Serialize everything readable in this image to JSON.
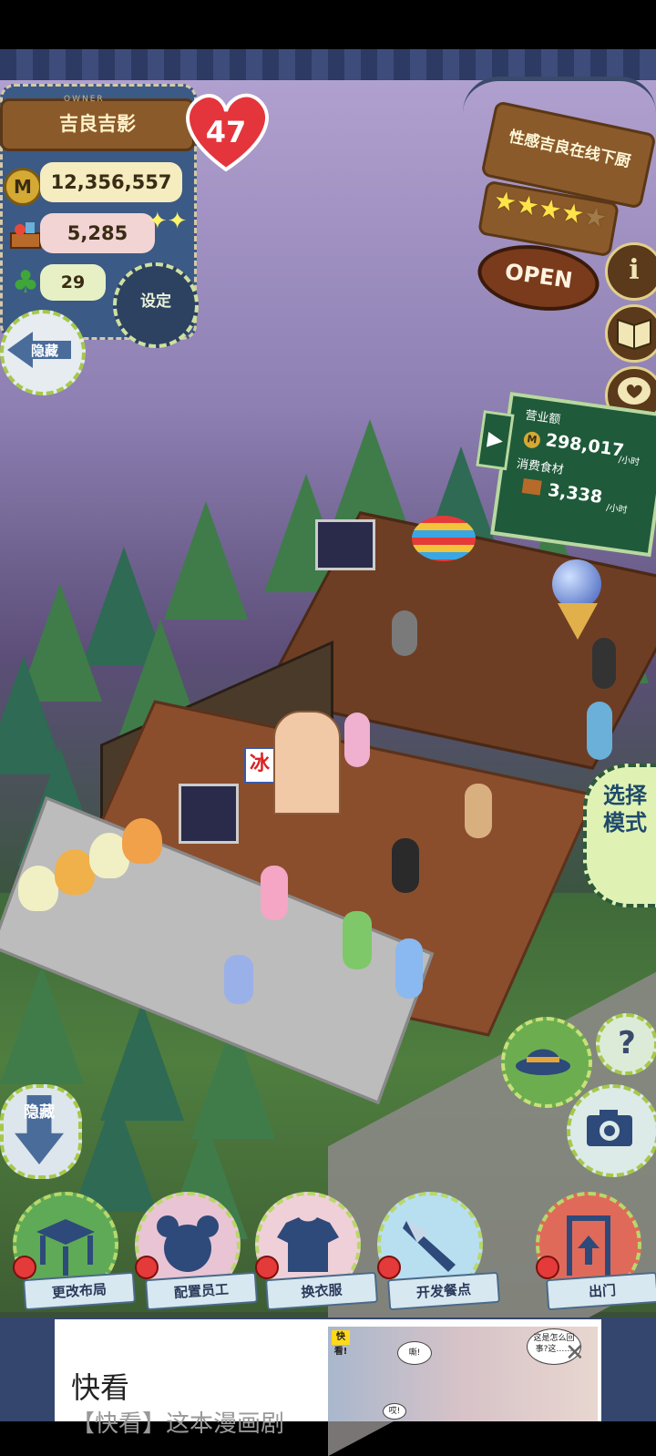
{
  "owner": {
    "label": "OWNER",
    "name": "吉良吉影",
    "level": "47"
  },
  "stats": {
    "coins": "12,356,557",
    "coin_symbol": "M",
    "food": "5,285",
    "clovers": "29"
  },
  "settings_label": "设定",
  "hide_label": "隐藏",
  "shop": {
    "name": "性感吉良在线下厨",
    "rating": 4,
    "max_rating": 5,
    "status": "OPEN"
  },
  "sales_board": {
    "revenue_label": "营业额",
    "revenue_value": "298,017",
    "revenue_unit": "/小时",
    "food_label": "消费食材",
    "food_value": "3,338",
    "food_unit": "/小时"
  },
  "mode_select_label": "选择模式",
  "help_symbol": "?",
  "info_symbol": "i",
  "menu": {
    "layout": "更改布局",
    "staff": "配置员工",
    "clothes": "换衣服",
    "dishes": "开发餐点",
    "exit": "出门"
  },
  "scene_signs": {
    "ice": "冰"
  },
  "ad": {
    "title": "快看",
    "description": "【快看】这本漫画剧",
    "logo": "快看!",
    "bubble1": "嘶!",
    "bubble2": "这是怎么回事?这……",
    "bubble3": "哎!"
  },
  "colors": {
    "panel_blue": "#3b5a86",
    "plank_brown": "#8b5a2b",
    "board_green": "#1f5a3a",
    "heart_red": "#e4353c",
    "star_yellow": "#ffe34a"
  }
}
